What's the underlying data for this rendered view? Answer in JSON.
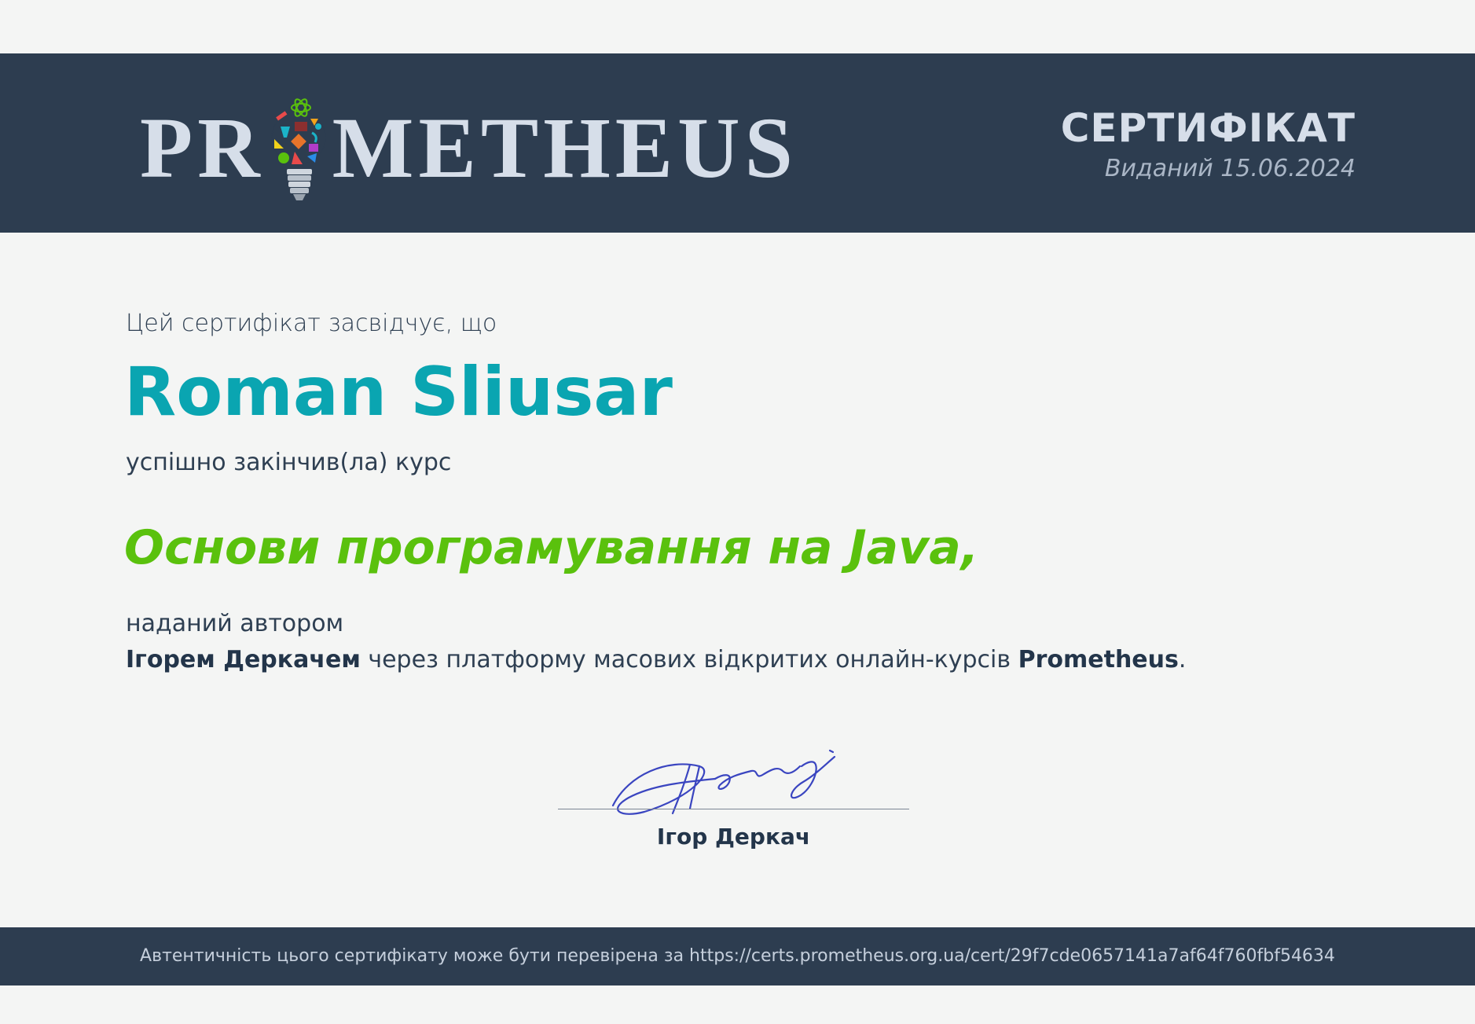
{
  "header": {
    "logo": {
      "text_before": "PR",
      "text_after": "METHEUS",
      "icon": "lightbulb-icon"
    },
    "title": "СЕРТИФІКАТ",
    "issued": "Виданий 15.06.2024"
  },
  "body": {
    "intro": "Цей сертифікат засвідчує, що",
    "student_name": "Roman Sliusar",
    "completed": "успішно закінчив(ла) курс",
    "course_name": "Основи програмування на Java,",
    "granted_by": "наданий автором",
    "author": "Ігорем Деркачем",
    "platform_text": " через платформу масових відкритих онлайн-курсів ",
    "platform": "Prometheus",
    "period": "."
  },
  "signature": {
    "name": "Ігор Деркач",
    "ink_color": "#3a45c0"
  },
  "footer": {
    "verification": "Автентичність цього сертифікату може бути перевірена за https://certs.prometheus.org.ua/cert/29f7cde0657141a7af64f760fbf54634"
  },
  "colors": {
    "band": "#2d3d50",
    "name": "#0aa5b1",
    "course": "#5ac10d"
  }
}
